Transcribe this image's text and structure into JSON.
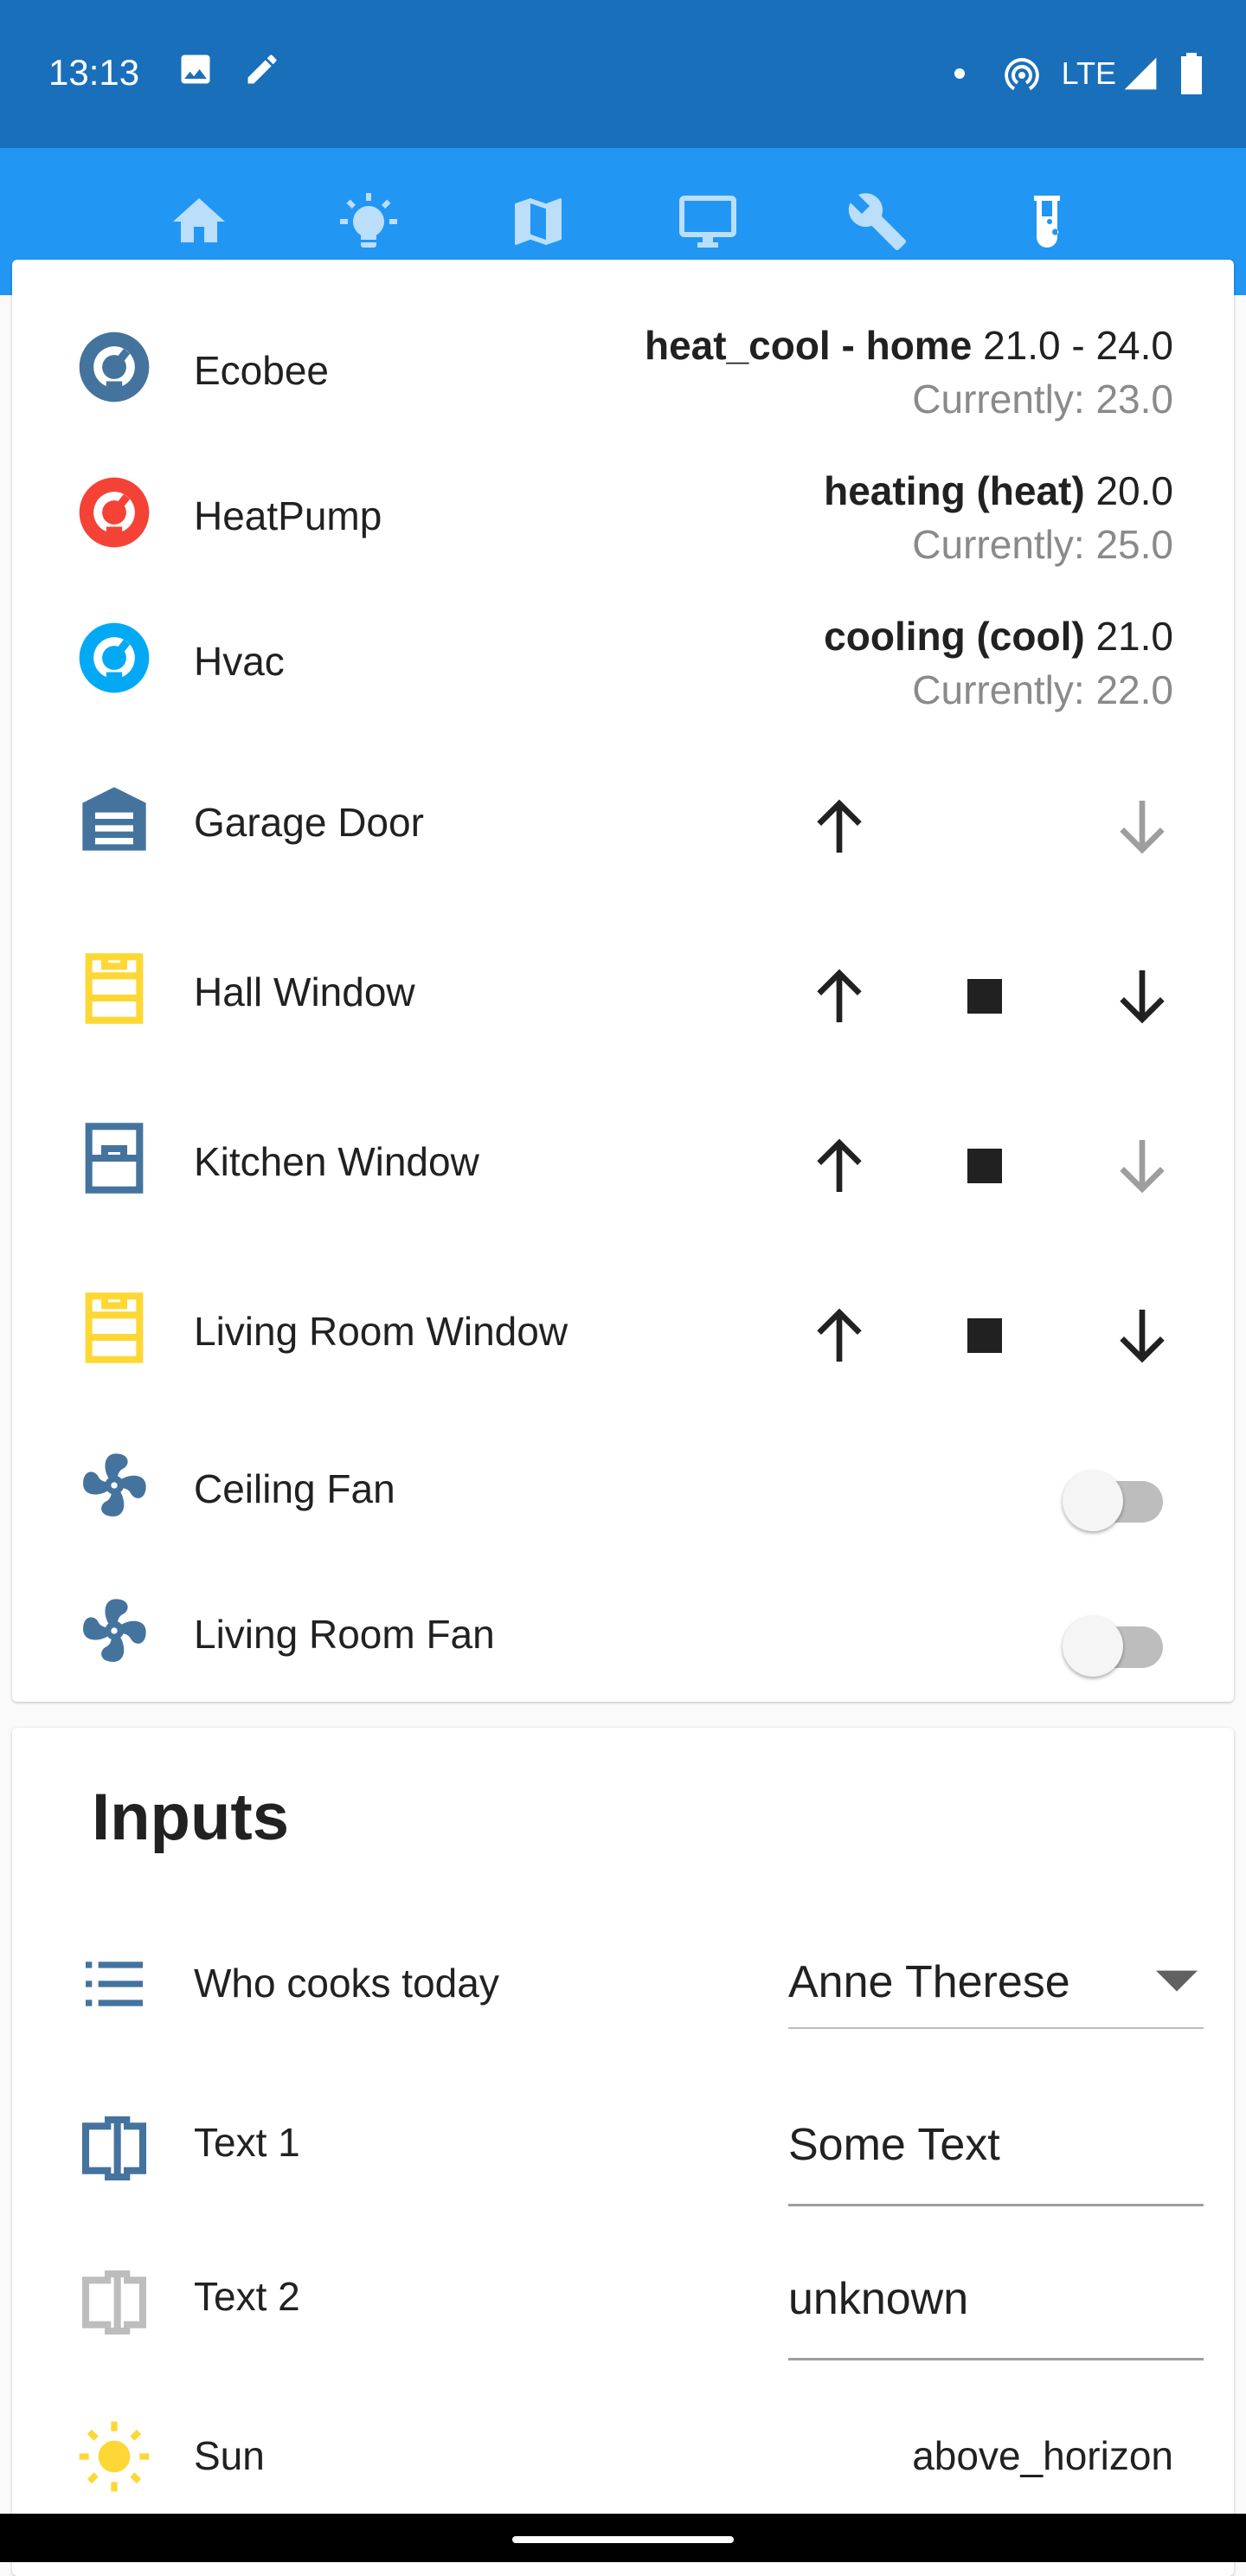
{
  "status_bar": {
    "time": "13:13",
    "network": "LTE"
  },
  "tabs": [
    {
      "icon": "home-icon",
      "active": false
    },
    {
      "icon": "lightbulb-icon",
      "active": false
    },
    {
      "icon": "map-icon",
      "active": false
    },
    {
      "icon": "monitor-icon",
      "active": false
    },
    {
      "icon": "wrench-icon",
      "active": false
    },
    {
      "icon": "test-tube-icon",
      "active": true
    }
  ],
  "climate": [
    {
      "name": "Ecobee",
      "state": "heat_cool - home",
      "target": "21.0 - 24.0",
      "current": "Currently: 23.0",
      "color": "#44739e"
    },
    {
      "name": "HeatPump",
      "state": "heating (heat)",
      "target": "20.0",
      "current": "Currently: 25.0",
      "color": "#f44336"
    },
    {
      "name": "Hvac",
      "state": "cooling (cool)",
      "target": "21.0",
      "current": "Currently: 22.0",
      "color": "#03a9f4"
    }
  ],
  "covers": [
    {
      "name": "Garage Door",
      "icon": "garage-icon",
      "color": "#44739e"
    },
    {
      "name": "Hall Window",
      "icon": "window-open-icon",
      "color": "#fdd835"
    },
    {
      "name": "Kitchen Window",
      "icon": "window-closed-icon",
      "color": "#44739e"
    },
    {
      "name": "Living Room Window",
      "icon": "window-open-icon",
      "color": "#fdd835"
    }
  ],
  "fans": [
    {
      "name": "Ceiling Fan",
      "on": false
    },
    {
      "name": "Living Room Fan",
      "on": false
    }
  ],
  "inputs": {
    "title": "Inputs",
    "who_cooks": {
      "label": "Who cooks today",
      "value": "Anne Therese"
    },
    "text1": {
      "label": "Text 1",
      "value": "Some Text"
    },
    "text2": {
      "label": "Text 2",
      "value": "unknown"
    },
    "sun": {
      "label": "Sun",
      "value": "above_horizon"
    }
  },
  "colors": {
    "status_bar": "#1a6fba",
    "app_bar": "#2196f3",
    "icon_blue": "#44739e",
    "icon_yellow": "#fdd835",
    "disabled": "#9e9e9e"
  }
}
